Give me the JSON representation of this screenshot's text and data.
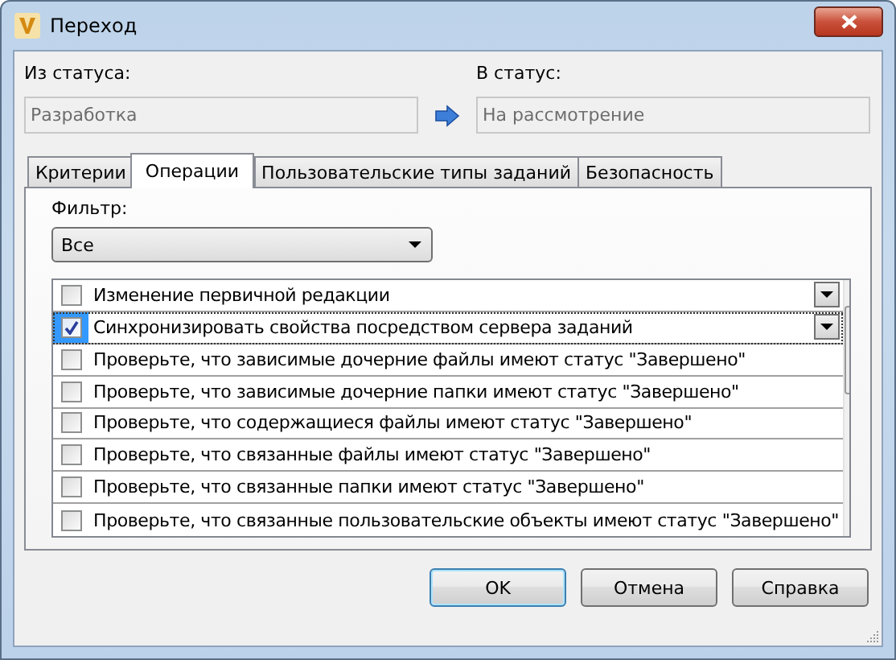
{
  "window": {
    "title": "Переход"
  },
  "from_status": {
    "label": "Из статуса:",
    "value": "Разработка",
    "disabled": true
  },
  "to_status": {
    "label": "В статус:",
    "value": "На рассмотрение",
    "disabled": true
  },
  "tabs": [
    {
      "label": "Критерии",
      "selected": false
    },
    {
      "label": "Операции",
      "selected": true
    },
    {
      "label": "Пользовательские типы заданий",
      "selected": false
    },
    {
      "label": "Безопасность",
      "selected": false
    }
  ],
  "filter": {
    "label": "Фильтр:",
    "value": "Все"
  },
  "operations": [
    {
      "label": "Изменение первичной редакции",
      "checked": false,
      "selected": false,
      "kind": "dropdown"
    },
    {
      "label": "Синхронизировать свойства посредством сервера заданий",
      "checked": true,
      "selected": true,
      "kind": "dropdown"
    },
    {
      "label": "Проверьте, что зависимые дочерние файлы имеют статус \"Завершено\"",
      "checked": false,
      "selected": false,
      "kind": "plain"
    },
    {
      "label": "Проверьте, что зависимые дочерние папки имеют статус \"Завершено\"",
      "checked": false,
      "selected": false,
      "kind": "plain"
    },
    {
      "label": "Проверьте, что содержащиеся файлы имеют статус \"Завершено\"",
      "checked": false,
      "selected": false,
      "kind": "plain"
    },
    {
      "label": "Проверьте, что связанные файлы имеют статус \"Завершено\"",
      "checked": false,
      "selected": false,
      "kind": "plain"
    },
    {
      "label": "Проверьте, что связанные папки имеют статус \"Завершено\"",
      "checked": false,
      "selected": false,
      "kind": "plain"
    },
    {
      "label": "Проверьте, что связанные пользовательские объекты имеют статус \"Завершено\"",
      "checked": false,
      "selected": false,
      "kind": "plain"
    }
  ],
  "buttons": [
    {
      "label": "OK",
      "default": true
    },
    {
      "label": "Отмена",
      "default": false
    },
    {
      "label": "Справка",
      "default": false
    }
  ]
}
